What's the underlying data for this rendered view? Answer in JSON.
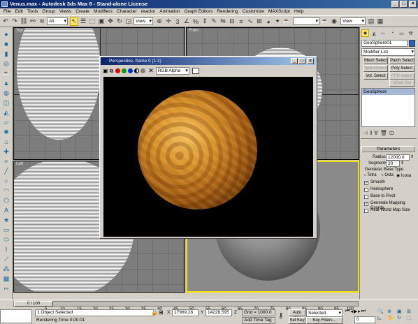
{
  "window": {
    "title": "Venus.max - Autodesk 3ds Max 8  - Stand-alone License"
  },
  "menu": [
    "File",
    "Edit",
    "Tools",
    "Group",
    "Views",
    "Create",
    "Modifiers",
    "Character",
    "reactor",
    "Animation",
    "Graph Editors",
    "Rendering",
    "Customize",
    "MAXScript",
    "Help"
  ],
  "toolbar": {
    "selection_filter": "All",
    "ref_coord": "View",
    "named_sets": "",
    "view_dd2": "View"
  },
  "viewports": {
    "top": "Top",
    "front": "Front",
    "left": "Left"
  },
  "frame_buffer": {
    "title": "Perspective, frame 0 (1:1)",
    "channel": "RGB Alpha"
  },
  "panel": {
    "object_name": "GeoSphere01",
    "modifier_list": "Modifier List",
    "buttons": {
      "mesh_select": "Mesh Select",
      "patch_select": "Patch Select",
      "spline_select": "SplineSelect",
      "poly_select": "Poly Select",
      "vol_select": "Vol. Select",
      "ffd_select": "FFD Select",
      "nsurf_sel": "NSurf Sel"
    },
    "stack_item": "GeoSphere",
    "rollout": "Parameters",
    "radius_label": "Radius:",
    "radius_value": "12000.0",
    "segments_label": "Segments:",
    "segments_value": "20",
    "geodesic_label": "Geodesic Base Type",
    "tetra": "Tetra",
    "octa": "Octa",
    "icosa": "Icosa",
    "smooth": "Smooth",
    "hemisphere": "Hemisphere",
    "base_to_pivot": "Base to Pivot",
    "gen_mapping": "Generate Mapping Coords.",
    "real_world": "Real-World Map Size"
  },
  "timeline": {
    "slider": "0 / 100",
    "ticks": [
      "5",
      "10",
      "15",
      "20",
      "25",
      "30",
      "35",
      "40",
      "45",
      "50",
      "55",
      "60",
      "65",
      "70",
      "75",
      "80",
      "85",
      "90",
      "95",
      "100"
    ]
  },
  "status": {
    "selected": "1 Object Selected",
    "render_time": "Rendering Time  0:00:01",
    "x_label": "X",
    "x_value": "17969.28",
    "y_label": "Y",
    "y_value": "14228.595",
    "z_label": "Z",
    "z_value": "",
    "grid": "Grid = 1000.0",
    "add_time_tag": "Add Time Tag",
    "auto_key": "Auto Key",
    "selected_dd": "Selected",
    "set_key": "Set Key",
    "key_filters": "Key Filters...",
    "frame": "0"
  }
}
